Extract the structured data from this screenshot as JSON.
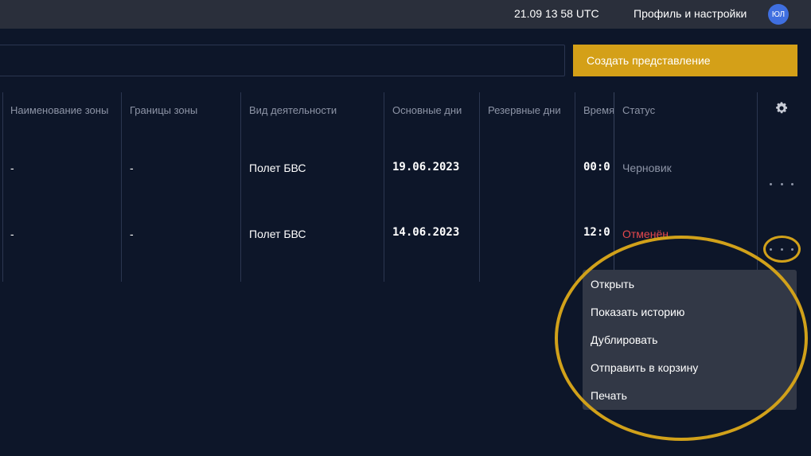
{
  "topbar": {
    "time": "21.09 13 58 UTC",
    "profile_label": "Профиль и настройки",
    "avatar_initials": "ЮЛ"
  },
  "toolbar": {
    "search_value": "",
    "create_view_label": "Создать представление"
  },
  "table": {
    "headers": {
      "zone_name": "Наименование зоны",
      "zone_bounds": "Границы зоны",
      "activity": "Вид деятельности",
      "main_days": "Основные дни",
      "reserve_days": "Резервные дни",
      "time": "Время",
      "status": "Статус"
    },
    "rows": [
      {
        "zone_name": "-",
        "zone_bounds": "-",
        "activity": "Полет БВС",
        "main_days": "19.06.2023",
        "reserve_days": "",
        "time": "00:0",
        "status": "Черновик"
      },
      {
        "zone_name": "-",
        "zone_bounds": "-",
        "activity": "Полет БВС",
        "main_days": "14.06.2023",
        "reserve_days": "",
        "time": "12:0",
        "status": "Отменён"
      }
    ]
  },
  "context_menu": {
    "items": [
      "Открыть",
      "Показать историю",
      "Дублировать",
      "Отправить в корзину",
      "Печать"
    ]
  },
  "colors": {
    "background": "#0d1629",
    "topbar": "#2a2f3b",
    "accent": "#d4a018",
    "status_draft": "#8d94a6",
    "status_cancelled": "#e5484d",
    "menu_bg": "#323846"
  },
  "icons": {
    "settings": "gear-icon",
    "row_actions": "more-horizontal-icon"
  }
}
